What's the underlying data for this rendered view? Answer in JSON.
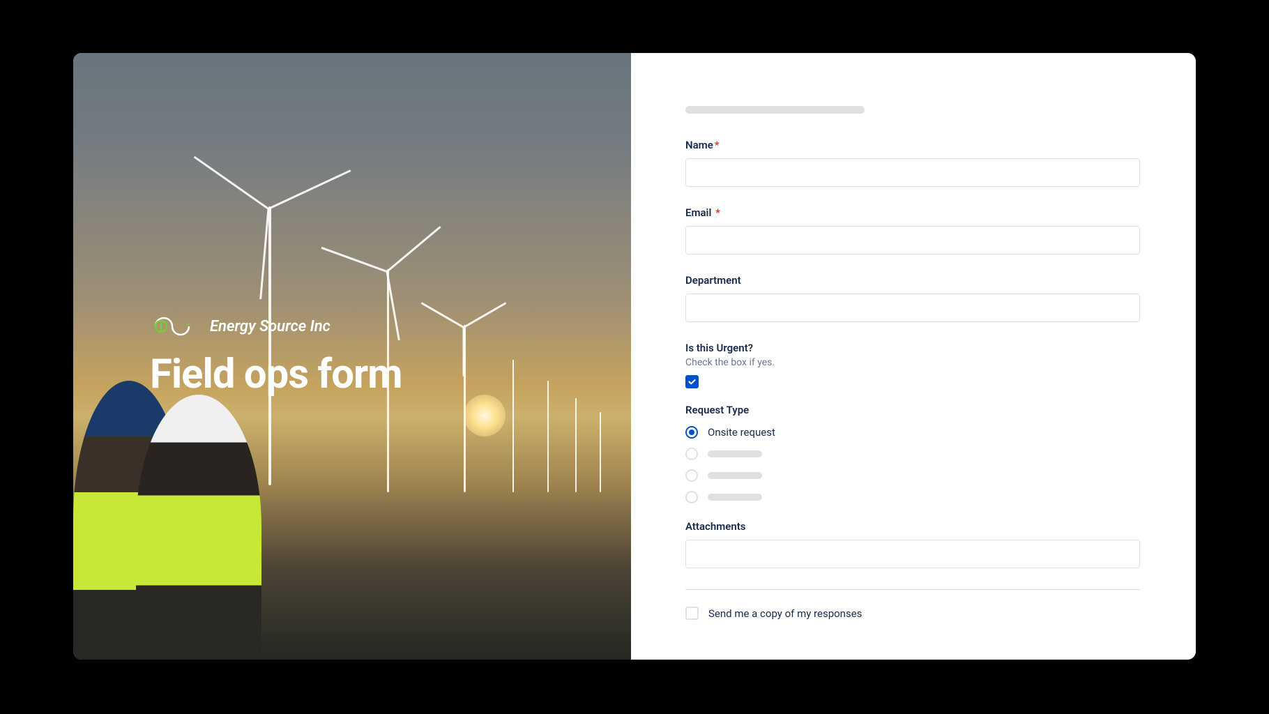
{
  "brand": {
    "name": "Energy Source Inc"
  },
  "hero": {
    "title": "Field ops form"
  },
  "form": {
    "name": {
      "label": "Name",
      "required": true
    },
    "email": {
      "label": "Email",
      "required": true
    },
    "department": {
      "label": "Department"
    },
    "urgent": {
      "label": "Is this Urgent?",
      "helper": "Check the box if yes.",
      "checked": true
    },
    "requestType": {
      "label": "Request Type",
      "options": [
        {
          "label": "Onsite request",
          "selected": true
        },
        {
          "label": "",
          "selected": false
        },
        {
          "label": "",
          "selected": false
        },
        {
          "label": "",
          "selected": false
        }
      ]
    },
    "attachments": {
      "label": "Attachments"
    },
    "copy": {
      "label": "Send me a copy of my responses",
      "checked": false
    }
  }
}
